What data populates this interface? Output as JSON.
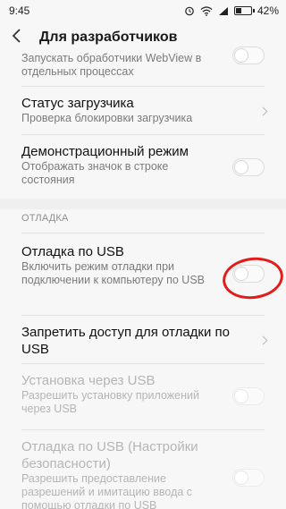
{
  "status_bar": {
    "time": "9:45",
    "battery_percent": "42%",
    "icons": [
      "alarm-icon",
      "wifi-icon",
      "cell-signal-icon",
      "battery-icon"
    ],
    "battery_level": 0.42
  },
  "header": {
    "title": "Для разработчиков",
    "back_icon": "back-arrow-icon"
  },
  "rows": [
    {
      "id": "webview",
      "subtitle": "Запускать обработчики WebView в отдельных процессах"
    },
    {
      "id": "bootloader",
      "title": "Статус загрузчика",
      "subtitle": "Проверка блокировки загрузчика"
    },
    {
      "id": "demo",
      "title": "Демонстрационный режим",
      "subtitle": "Отображать значок в строке состояния"
    },
    {
      "id": "usb_debug",
      "title": "Отладка по USB",
      "subtitle": "Включить режим отладки при подключении к компьютеру по USB"
    },
    {
      "id": "revoke_usb",
      "title": "Запретить доступ для отладки по USB"
    },
    {
      "id": "usb_install",
      "title": "Установка через USB",
      "subtitle": "Разрешить установку приложений через USB"
    },
    {
      "id": "usb_security",
      "title": "Отладка по USB (Настройки безопасности)",
      "subtitle": "Разрешить предоставление разрешений и имитацию ввода с помощью отладки по USB"
    }
  ],
  "section": {
    "debug_label": "ОТЛАДКА"
  },
  "accent": {
    "highlight_color": "#e21b1b"
  }
}
